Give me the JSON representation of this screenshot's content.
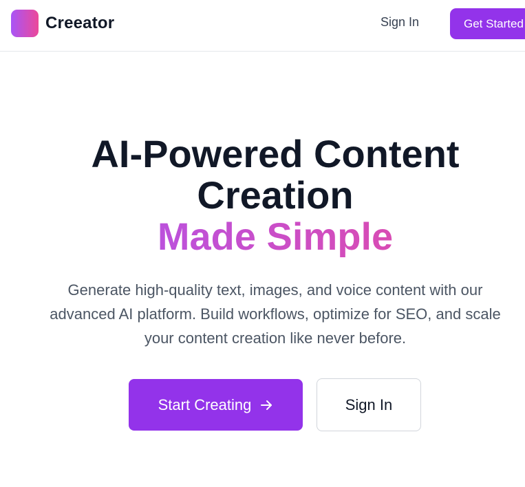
{
  "header": {
    "brand_name": "Creeator",
    "logo_icon": "gradient-square-logo",
    "sign_in_label": "Sign In",
    "get_started_label": "Get Started"
  },
  "hero": {
    "title_line1": "AI-Powered Content",
    "title_line2": "Creation",
    "title_accent": "Made Simple",
    "subtitle_line1": "Generate high-quality text, images, and voice content with our",
    "subtitle_line2": "advanced AI platform. Build workflows, optimize for SEO, and scale",
    "subtitle_line3": "your content creation like never before.",
    "primary_cta_label": "Start Creating",
    "primary_cta_icon": "arrow-right-icon",
    "secondary_cta_label": "Sign In"
  },
  "colors": {
    "brand_purple": "#9333ea",
    "gradient_start": "#a855f7",
    "gradient_end": "#ec4899",
    "heading": "#111827",
    "body_text": "#4b5563"
  }
}
